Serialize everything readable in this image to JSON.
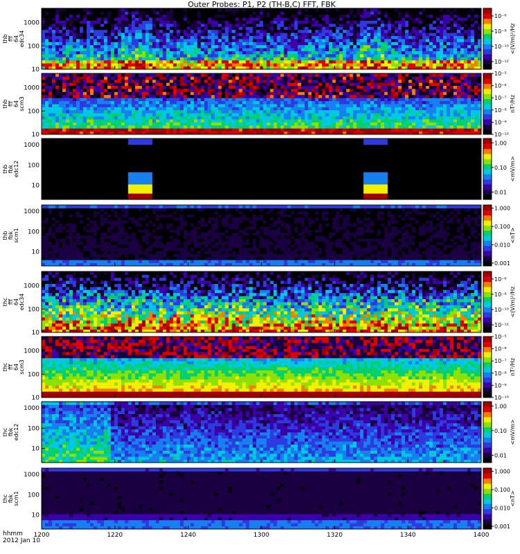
{
  "title": "Outer Probes: P1, P2 (TH-B,C) FFT, FBK",
  "footer": {
    "time_label": "hhmm",
    "date_label": "2012 Jan 10"
  },
  "x_ticks": [
    "1200",
    "1220",
    "1240",
    "1300",
    "1320",
    "1340",
    "1400"
  ],
  "chart_data": [
    {
      "type": "heatmap",
      "ylabel": [
        "thb",
        "fff",
        "64",
        "edc34"
      ],
      "yscale": "log",
      "ylim": [
        10,
        4096
      ],
      "y_ticks": [
        "10",
        "100",
        "1000"
      ],
      "colorbar": {
        "label": "<(V/m)²/Hz",
        "ticks": [
          "10⁻⁶",
          "10⁻⁸",
          "10⁻¹⁰",
          "10⁻¹²"
        ],
        "scale": "log",
        "range": [
          1e-13,
          1e-05
        ]
      }
    },
    {
      "type": "heatmap",
      "ylabel": [
        "thb",
        "fff",
        "64",
        "scm3"
      ],
      "yscale": "log",
      "ylim": [
        10,
        4096
      ],
      "y_ticks": [
        "10",
        "100",
        "1000"
      ],
      "colorbar": {
        "label": "nT²/Hz",
        "ticks": [
          "10⁻⁵",
          "10⁻⁶",
          "10⁻⁷",
          "10⁻⁸",
          "10⁻⁹",
          "10⁻¹⁰"
        ],
        "scale": "log",
        "range": [
          1e-10,
          1e-05
        ]
      }
    },
    {
      "type": "heatmap",
      "ylabel": [
        "thb",
        "fbk",
        "edc12"
      ],
      "yscale": "log",
      "ylim": [
        2,
        2048
      ],
      "y_ticks": [
        "10",
        "100",
        "1000"
      ],
      "colorbar": {
        "label": "<mV/m>",
        "ticks": [
          "1.00",
          "0.10",
          "0.01"
        ],
        "scale": "log",
        "range": [
          0.005,
          1.5
        ]
      }
    },
    {
      "type": "heatmap",
      "ylabel": [
        "thb",
        "fbk",
        "scm1"
      ],
      "yscale": "log",
      "ylim": [
        2,
        2048
      ],
      "y_ticks": [
        "10",
        "100",
        "1000"
      ],
      "colorbar": {
        "label": "<nT>",
        "ticks": [
          "1.000",
          "0.100",
          "0.010",
          "0.001"
        ],
        "scale": "log",
        "range": [
          0.0007,
          1.5
        ]
      }
    },
    {
      "type": "heatmap",
      "ylabel": [
        "thc",
        "fff",
        "64",
        "edc34"
      ],
      "yscale": "log",
      "ylim": [
        10,
        4096
      ],
      "y_ticks": [
        "10",
        "100",
        "1000"
      ],
      "colorbar": {
        "label": "<(V/m)²/Hz",
        "ticks": [
          "10⁻⁶",
          "10⁻⁸",
          "10⁻¹⁰",
          "10⁻¹²"
        ],
        "scale": "log",
        "range": [
          1e-13,
          1e-05
        ]
      }
    },
    {
      "type": "heatmap",
      "ylabel": [
        "thc",
        "fff",
        "64",
        "scm3"
      ],
      "yscale": "log",
      "ylim": [
        10,
        4096
      ],
      "y_ticks": [
        "10",
        "100",
        "1000"
      ],
      "colorbar": {
        "label": "nT²/Hz",
        "ticks": [
          "10⁻⁵",
          "10⁻⁶",
          "10⁻⁷",
          "10⁻⁸",
          "10⁻⁹",
          "10⁻¹⁰"
        ],
        "scale": "log",
        "range": [
          1e-10,
          1e-05
        ]
      }
    },
    {
      "type": "heatmap",
      "ylabel": [
        "thc",
        "fbk",
        "edc12"
      ],
      "yscale": "log",
      "ylim": [
        2,
        2048
      ],
      "y_ticks": [
        "10",
        "100",
        "1000"
      ],
      "colorbar": {
        "label": "<mV/m>",
        "ticks": [
          "1.00",
          "0.10",
          "0.01"
        ],
        "scale": "log",
        "range": [
          0.005,
          1.5
        ]
      }
    },
    {
      "type": "heatmap",
      "ylabel": [
        "thc",
        "fbk",
        "scm1"
      ],
      "yscale": "log",
      "ylim": [
        2,
        2048
      ],
      "y_ticks": [
        "10",
        "100",
        "1000"
      ],
      "colorbar": {
        "label": "<nT>",
        "ticks": [
          "1.000",
          "0.100",
          "0.010",
          "0.001"
        ],
        "scale": "log",
        "range": [
          0.0007,
          1.5
        ]
      }
    }
  ],
  "x_axis": {
    "range": [
      "12:00",
      "14:00"
    ],
    "ticks_minutes": [
      0,
      20,
      40,
      60,
      80,
      100,
      120
    ]
  },
  "colormap": [
    "#000000",
    "#1a0040",
    "#3b00a8",
    "#2c3ae0",
    "#1680f0",
    "#00c8e0",
    "#00d070",
    "#8ee000",
    "#f0f000",
    "#f08000",
    "#e00000",
    "#a00000"
  ]
}
